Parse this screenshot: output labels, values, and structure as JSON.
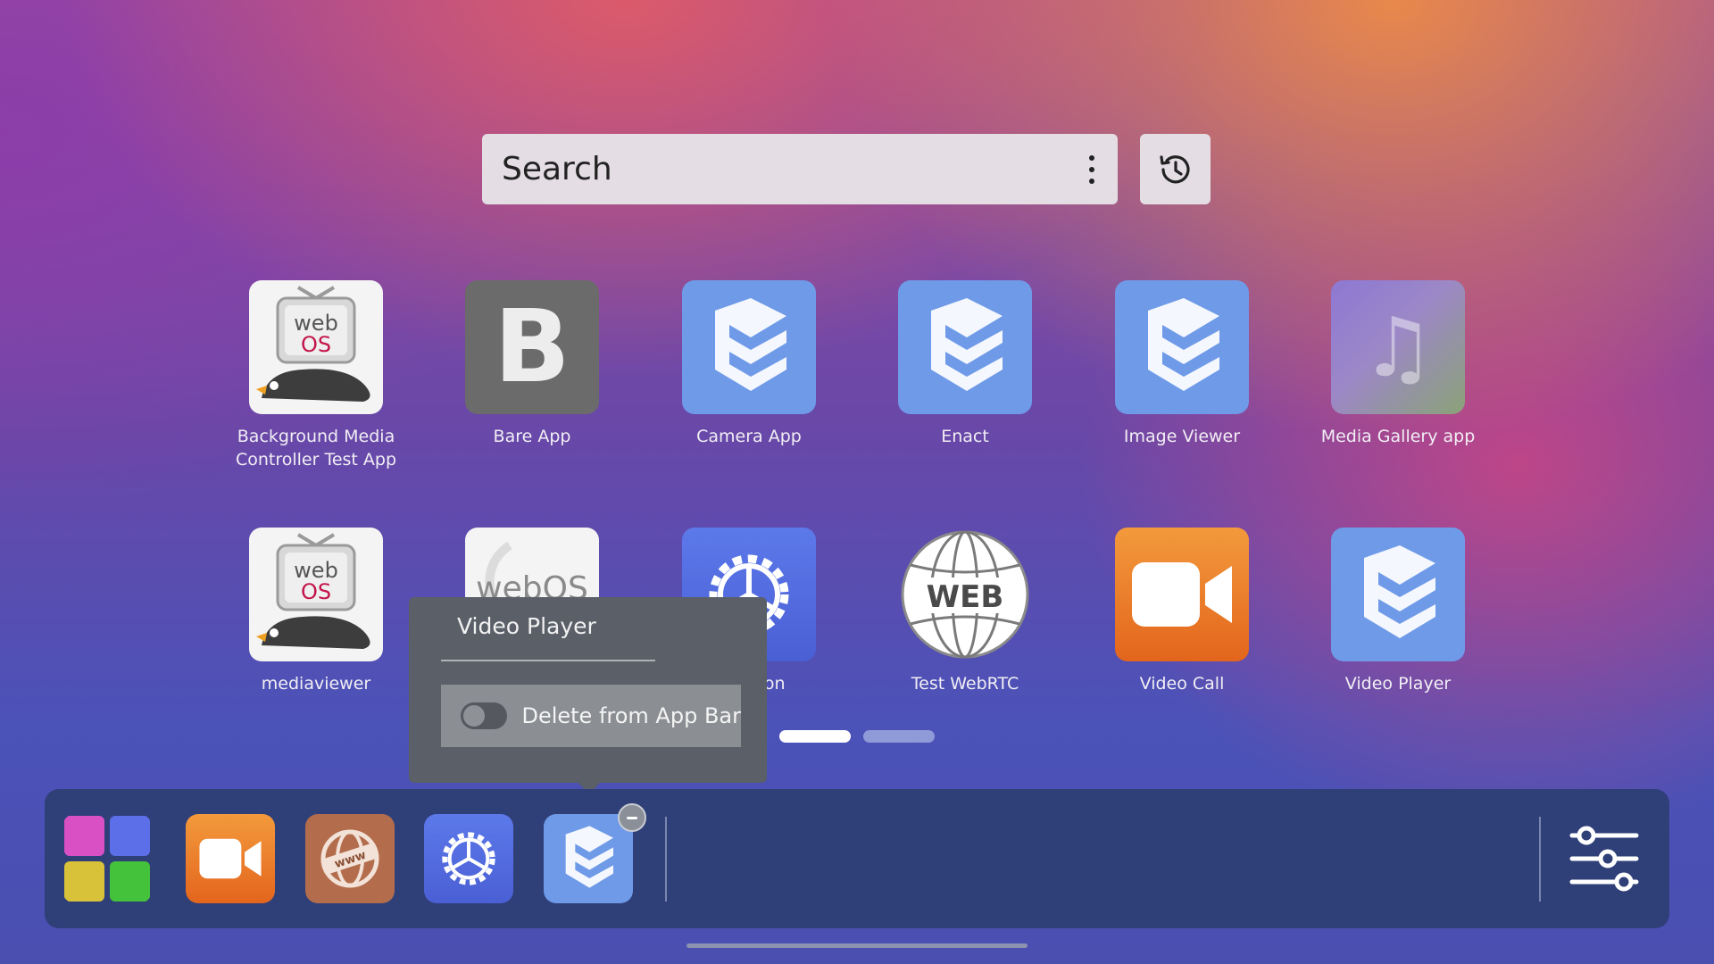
{
  "search": {
    "placeholder": "Search"
  },
  "apps_row1": [
    {
      "label_line1": "Background Media",
      "label_line2": "Controller Test App",
      "icon": "webos-penguin-icon"
    },
    {
      "label": "Bare App",
      "icon": "letter-b-icon",
      "glyph": "B"
    },
    {
      "label": "Camera App",
      "icon": "enact-icon"
    },
    {
      "label": "Enact",
      "icon": "enact-icon"
    },
    {
      "label": "Image Viewer",
      "icon": "enact-icon"
    },
    {
      "label": "Media Gallery app",
      "icon": "music-note-icon",
      "glyph": "♫"
    }
  ],
  "apps_row2": [
    {
      "label": "mediaviewer",
      "icon": "webos-penguin-icon"
    },
    {
      "label": "",
      "icon": "webos-logo-icon"
    },
    {
      "label": "plication",
      "icon": "settings-gear-icon"
    },
    {
      "label": "Test WebRTC",
      "icon": "web-globe-icon",
      "glyph": "WEB"
    },
    {
      "label": "Video Call",
      "icon": "video-camera-icon"
    },
    {
      "label": "Video Player",
      "icon": "enact-icon"
    }
  ],
  "webos_text": {
    "line1": "web",
    "line2": "OS",
    "logo": "webOS"
  },
  "popup": {
    "title": "Video Player",
    "action_label": "Delete from App Bar",
    "toggle_on": false
  },
  "pagination": {
    "pages": 2,
    "current": 1
  },
  "app_bar": {
    "items": [
      {
        "name": "all-apps",
        "icon": "app-grid-icon"
      },
      {
        "name": "video-call",
        "icon": "video-camera-icon"
      },
      {
        "name": "browser",
        "icon": "www-globe-icon",
        "glyph": "www"
      },
      {
        "name": "settings",
        "icon": "settings-gear-icon"
      },
      {
        "name": "video-player",
        "icon": "enact-icon"
      }
    ],
    "settings_icon": "sliders-icon"
  },
  "colors": {
    "tile_blue": "#6f9ae8",
    "app_bar": "#2f3f78",
    "popup": "#5a5f68",
    "active_page": "#ffffff",
    "inactive_page": "#8e9bd8"
  }
}
